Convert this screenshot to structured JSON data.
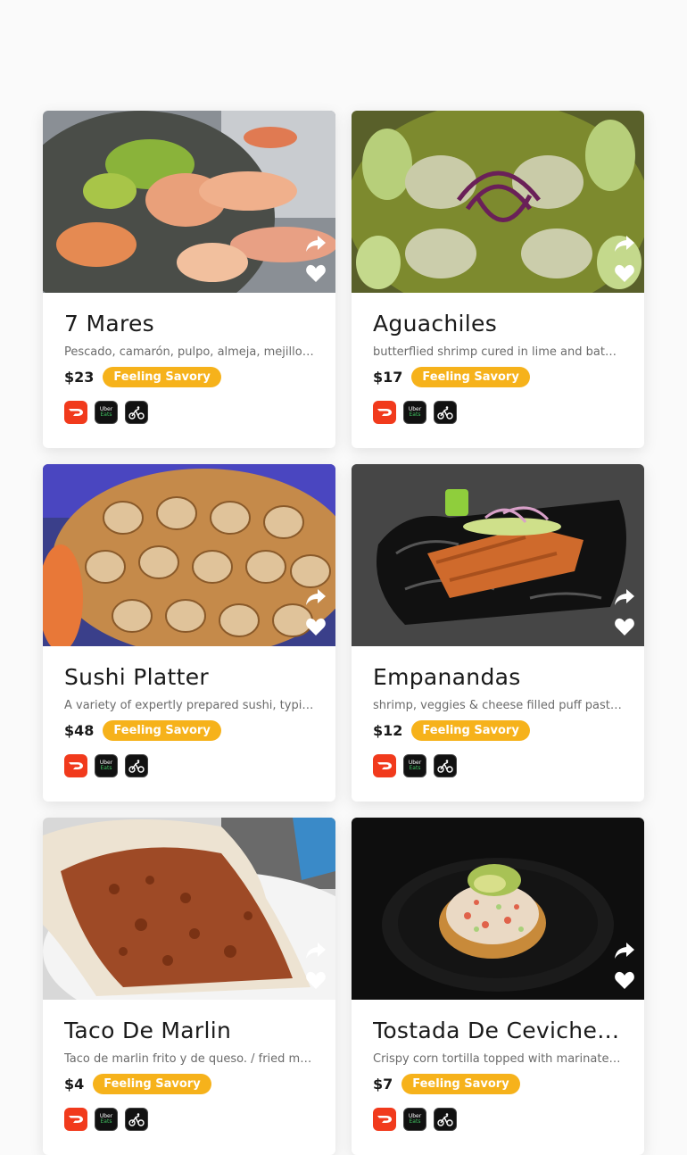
{
  "icons": {
    "share": "share-arrow-icon",
    "favorite": "heart-icon",
    "doordash": "doordash-icon",
    "ubereats": "ubereats-icon",
    "postmates": "postmates-icon"
  },
  "colors": {
    "tag_bg": "#f6b21b",
    "doordash": "#f13a1c",
    "ubereats_bg": "#111111",
    "ubereats_green": "#3fc060"
  },
  "ubereats_badge": {
    "line1": "Uber",
    "line2": "Eats"
  },
  "items": [
    {
      "title": "7 Mares",
      "description": "Pescado, camarón, pulpo, almeja, mejillones, jaiba y más",
      "price": "$23",
      "tag": "Feeling Savory"
    },
    {
      "title": "Aguachiles",
      "description": "butterflied shrimp cured in lime and bathed in a spicy green sauce",
      "price": "$17",
      "tag": "Feeling Savory"
    },
    {
      "title": "Sushi Platter",
      "description": "A variety of expertly prepared sushi, typically including rolls",
      "price": "$48",
      "tag": "Feeling Savory"
    },
    {
      "title": "Empanandas",
      "description": "shrimp, veggies & cheese filled puff pastry empanadas",
      "price": "$12",
      "tag": "Feeling Savory"
    },
    {
      "title": "Taco De Marlin",
      "description": "Taco de marlin frito y de queso. / fried marlin taco with cheese",
      "price": "$4",
      "tag": "Feeling Savory"
    },
    {
      "title": "Tostada De Ceviche De Camarón",
      "description": "Crispy corn tortilla topped with marinated shrimp ceviche",
      "price": "$7",
      "tag": "Feeling Savory"
    }
  ]
}
